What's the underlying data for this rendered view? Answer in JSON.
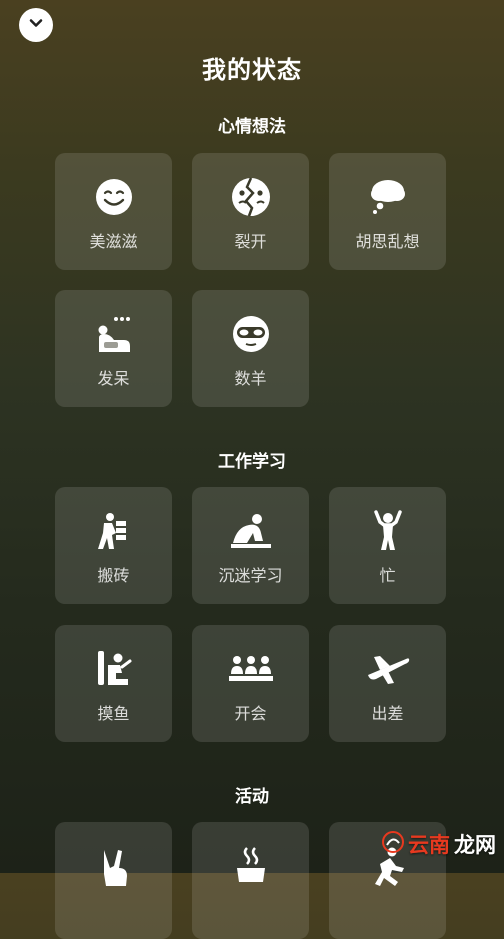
{
  "header": {
    "title": "我的状态"
  },
  "sections": [
    {
      "title": "心情想法",
      "items": [
        {
          "label": "美滋滋",
          "icon": "smiley-face-icon"
        },
        {
          "label": "裂开",
          "icon": "cracked-face-icon"
        },
        {
          "label": "胡思乱想",
          "icon": "thought-cloud-icon"
        },
        {
          "label": "发呆",
          "icon": "sitting-idle-icon"
        },
        {
          "label": "数羊",
          "icon": "sleep-mask-face-icon"
        }
      ]
    },
    {
      "title": "工作学习",
      "items": [
        {
          "label": "搬砖",
          "icon": "carrying-bricks-icon"
        },
        {
          "label": "沉迷学习",
          "icon": "studying-person-icon"
        },
        {
          "label": "忙",
          "icon": "busy-person-icon"
        },
        {
          "label": "摸鱼",
          "icon": "slacking-person-icon"
        },
        {
          "label": "开会",
          "icon": "meeting-icon"
        },
        {
          "label": "出差",
          "icon": "airplane-icon"
        }
      ]
    },
    {
      "title": "活动"
    }
  ],
  "watermark": {
    "prefix": "云南",
    "suffix": "龙网"
  }
}
